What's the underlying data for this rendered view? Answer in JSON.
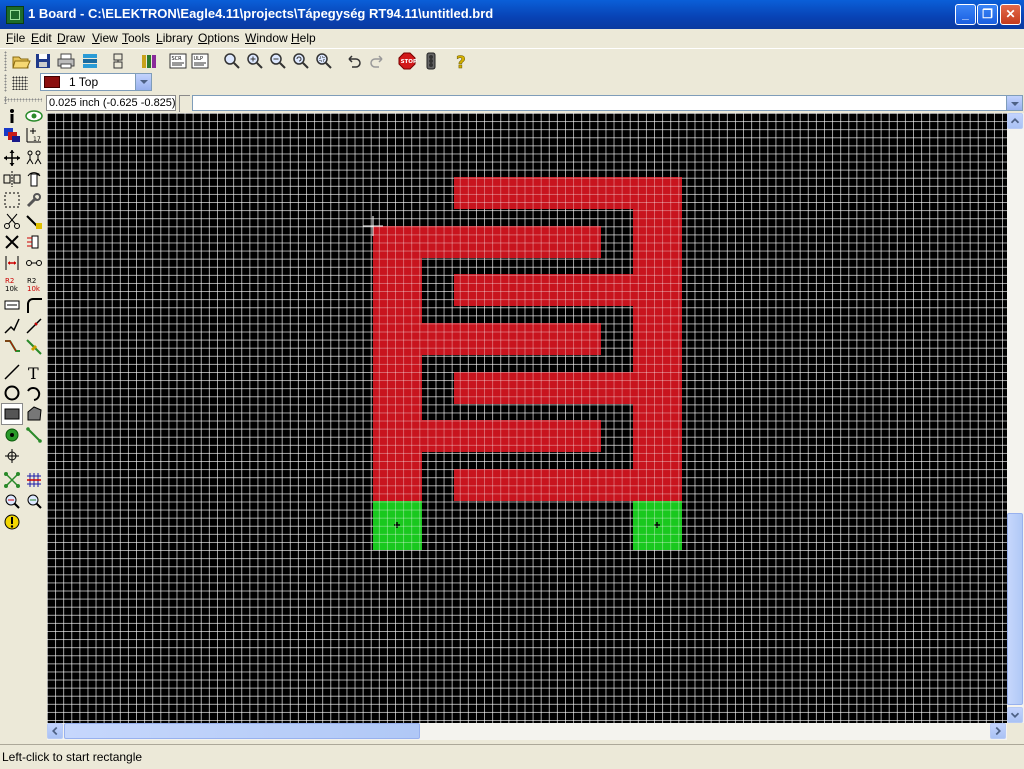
{
  "window": {
    "title": "1 Board - C:\\ELEKTRON\\Eagle4.11\\projects\\Tápegység RT94.11\\untitled.brd"
  },
  "menu": [
    "File",
    "Edit",
    "Draw",
    "View",
    "Tools",
    "Library",
    "Options",
    "Window",
    "Help"
  ],
  "toolbar": {
    "icons": [
      "open-icon",
      "save-icon",
      "print-icon",
      "cam-processor-icon",
      "schematic-board-switch-icon",
      "library-icon",
      "script-icon",
      "ulp-icon",
      "zoom-fit-icon",
      "zoom-in-icon",
      "zoom-out-icon",
      "zoom-redraw-icon",
      "zoom-select-icon",
      "undo-icon",
      "redo-icon",
      "stop-icon",
      "go-icon",
      "help-icon"
    ]
  },
  "layer": {
    "selected": "1 Top",
    "color": "#8b0e0e"
  },
  "coordinates": "0.025 inch (-0.625 -0.825)",
  "command": {
    "value": ""
  },
  "left_tools": [
    "info-icon",
    "show-icon",
    "display-layers-icon",
    "mark-icon",
    "move-icon",
    "copy-icon",
    "mirror-icon",
    "rotate-icon",
    "group-icon",
    "change-icon",
    "cut-icon",
    "paste-icon",
    "delete-icon",
    "add-icon",
    "pinswap-icon",
    "replace-icon",
    "name-icon",
    "value-icon",
    "smash-icon",
    "miter-icon",
    "split-icon",
    "optimize-icon",
    "route-icon",
    "ripup-icon",
    "wire-icon",
    "text-icon",
    "circle-icon",
    "arc-icon",
    "rectangle-icon",
    "polygon-icon",
    "via-icon",
    "signal-icon",
    "hole-icon",
    "ratsnest-icon",
    "auto-router-icon",
    "erc-icon",
    "drc-icon",
    "errors-icon"
  ],
  "canvas": {
    "background": "#000000",
    "copper_color": "#c8141e",
    "pad_color": "#19c81e"
  },
  "status": "Left-click to start rectangle"
}
